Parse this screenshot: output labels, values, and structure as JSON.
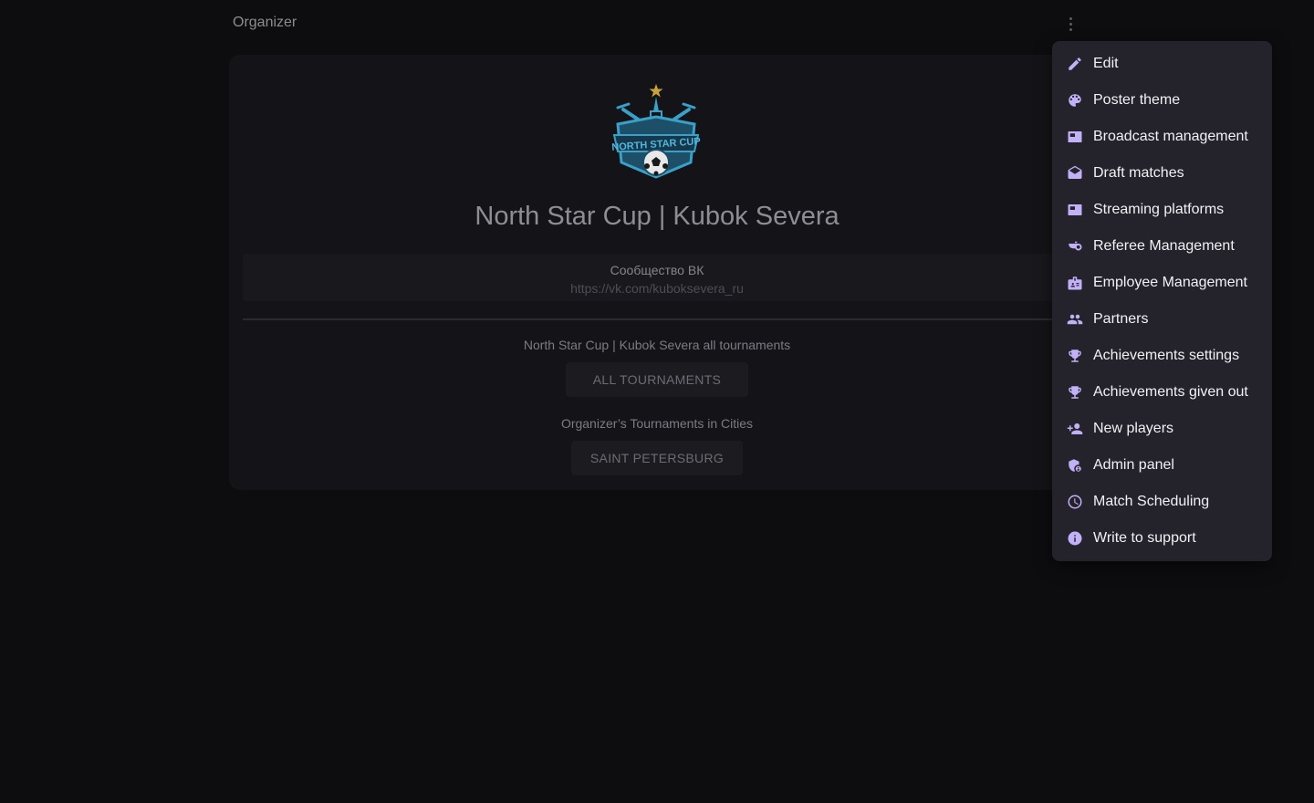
{
  "header": {
    "title": "Organizer"
  },
  "organizer": {
    "name": "North Star Cup | Kubok Severa",
    "community_label": "Сообщество ВК",
    "community_link": "https://vk.com/kuboksevera_ru",
    "tournaments_label": "North Star Cup | Kubok Severa all tournaments",
    "tournaments_button": "ALL TOURNAMENTS",
    "cities_label": "Organizer’s Tournaments in Cities",
    "city_button": "SAINT PETERSBURG"
  },
  "menu": {
    "items": [
      {
        "label": "Edit",
        "icon": "pencil-icon"
      },
      {
        "label": "Poster theme",
        "icon": "palette-icon"
      },
      {
        "label": "Broadcast management",
        "icon": "broadcast-icon"
      },
      {
        "label": "Draft matches",
        "icon": "drafts-icon"
      },
      {
        "label": "Streaming platforms",
        "icon": "streaming-icon"
      },
      {
        "label": "Referee Management",
        "icon": "whistle-icon"
      },
      {
        "label": "Employee Management",
        "icon": "badge-icon"
      },
      {
        "label": "Partners",
        "icon": "people-icon"
      },
      {
        "label": "Achievements settings",
        "icon": "trophy-icon"
      },
      {
        "label": "Achievements given out",
        "icon": "trophy-icon"
      },
      {
        "label": "New players",
        "icon": "person-add-icon"
      },
      {
        "label": "Admin panel",
        "icon": "admin-shield-icon"
      },
      {
        "label": "Match Scheduling",
        "icon": "clock-icon"
      },
      {
        "label": "Write to support",
        "icon": "info-icon"
      }
    ]
  },
  "colors": {
    "menu_icon": "#c3b1f7",
    "menu_bg": "#24232b",
    "page_bg": "#0d0d10",
    "card_bg": "#141418"
  }
}
